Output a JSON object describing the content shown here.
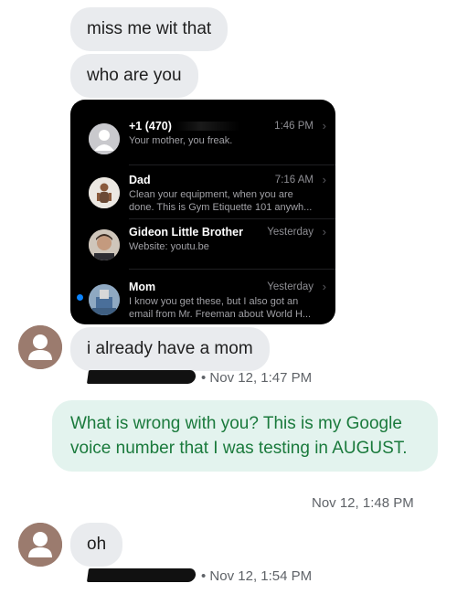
{
  "messages": {
    "m1": "miss me wit that",
    "m2": "who are you",
    "m3": "i already have a mom",
    "m4": "What is wrong with you? This is my Google voice number that I was testing in AUGUST.",
    "m5": "oh"
  },
  "meta": {
    "t1": "• Nov 12, 1:47 PM",
    "t2": "Nov 12, 1:48 PM",
    "t3": "• Nov 12, 1:54 PM"
  },
  "screenshot": {
    "rows": [
      {
        "name": "+1 (470)",
        "time": "1:46 PM",
        "preview": "Your mother, you freak."
      },
      {
        "name": "Dad",
        "time": "7:16 AM",
        "preview": "Clean your equipment, when you are done. This is Gym Etiquette 101 anywh..."
      },
      {
        "name": "Gideon Little Brother",
        "time": "Yesterday",
        "preview": "Website: youtu.be"
      },
      {
        "name": "Mom",
        "time": "Yesterday",
        "preview": "I know you get these, but I also got an email from Mr. Freeman about World H..."
      }
    ]
  },
  "colors": {
    "incoming_bubble": "#e9ebee",
    "outgoing_bubble": "#e3f3ee",
    "outgoing_text": "#1a7a3c",
    "avatar": "#9b7b6e",
    "screenshot_bg": "#000000",
    "unread_dot": "#0a84ff"
  },
  "icons": {
    "contact_avatar": "person-icon",
    "chevron": "chevron-right-icon"
  }
}
